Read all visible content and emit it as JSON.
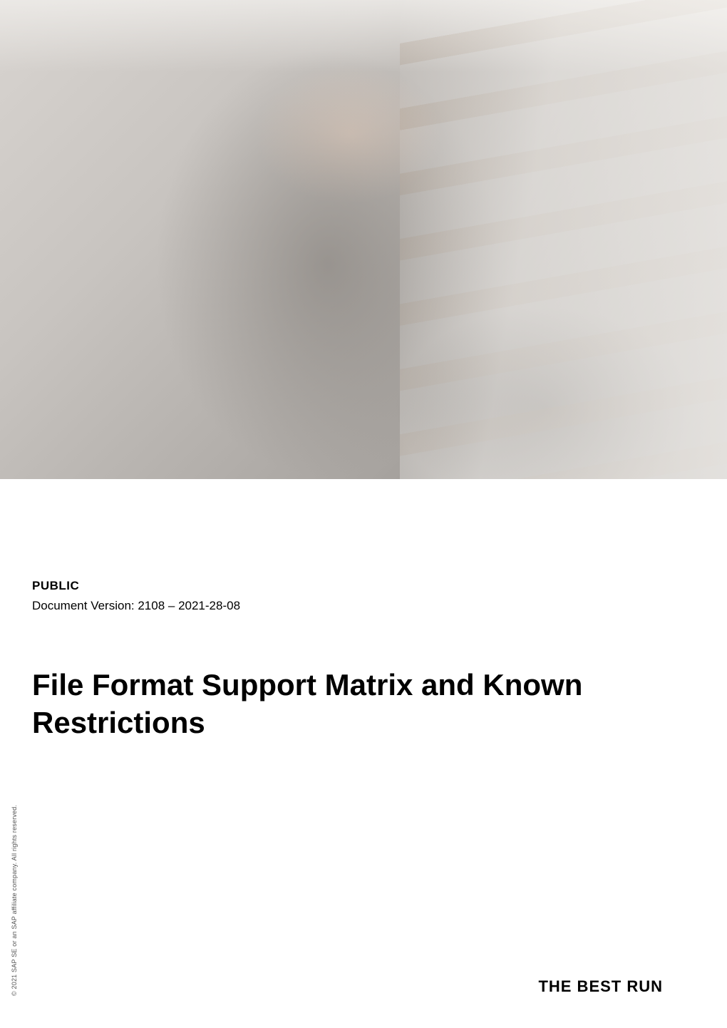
{
  "hero": {
    "alt": "Person wearing a grey hooded sweatshirt looking at a tablet device in a bright interior setting"
  },
  "meta": {
    "classification": "PUBLIC",
    "version_label": "Document Version: 2108 – 2021-28-08"
  },
  "title": "File Format Support Matrix and Known Restrictions",
  "footer": {
    "copyright": "© 2021 SAP SE or an SAP affiliate company. All rights reserved.",
    "tagline": "THE BEST RUN"
  }
}
